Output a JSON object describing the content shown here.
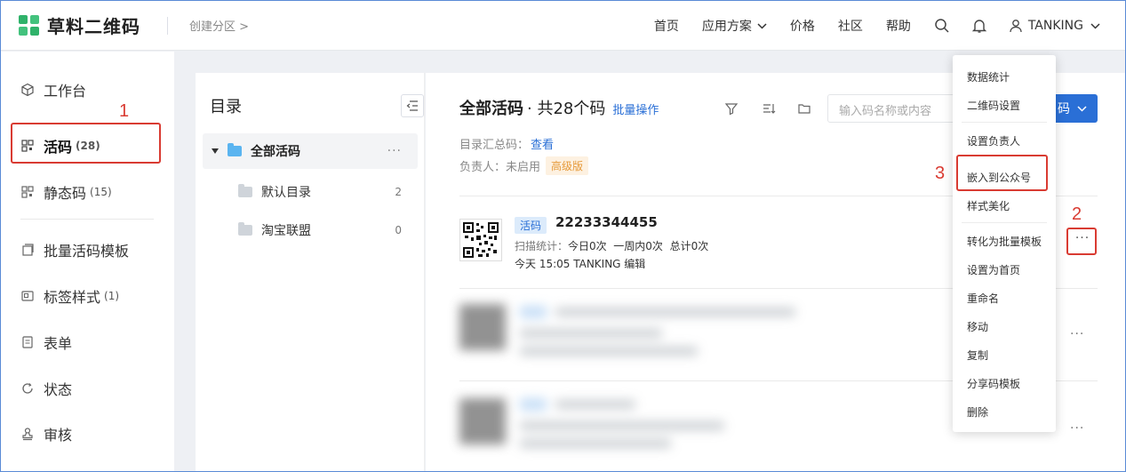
{
  "header": {
    "brand": "草料二维码",
    "breadcrumb": "创建分区 >",
    "nav": [
      {
        "label": "首页"
      },
      {
        "label": "应用方案"
      },
      {
        "label": "价格"
      },
      {
        "label": "社区"
      },
      {
        "label": "帮助"
      }
    ],
    "user": "TANKING"
  },
  "sidebar": {
    "items": [
      {
        "label": "工作台",
        "count": ""
      },
      {
        "label": "活码",
        "count": "(28)"
      },
      {
        "label": "静态码",
        "count": "(15)"
      },
      {
        "label": "批量活码模板",
        "count": ""
      },
      {
        "label": "标签样式",
        "count": "(1)"
      },
      {
        "label": "表单",
        "count": ""
      },
      {
        "label": "状态",
        "count": ""
      },
      {
        "label": "审核",
        "count": ""
      }
    ]
  },
  "directory": {
    "title": "目录",
    "root": "全部活码",
    "children": [
      {
        "label": "默认目录",
        "count": "2"
      },
      {
        "label": "淘宝联盟",
        "count": "0"
      }
    ]
  },
  "main": {
    "title": "全部活码",
    "count_text": "· 共28个码",
    "batch_label": "批量操作",
    "search_placeholder": "输入码名称或内容",
    "create_button": "码",
    "summary_label": "目录汇总码：",
    "summary_link": "查看",
    "owner_label": "负责人：未启用",
    "owner_badge": "高级版",
    "item": {
      "tag": "活码",
      "name": "22233344455",
      "stats_label": "扫描统计：",
      "stats_today": "今日0次",
      "stats_week": "一周内0次",
      "stats_total": "总计0次",
      "time_line": "今天 15:05  TANKING  编辑"
    },
    "more": "···"
  },
  "menu": {
    "items": [
      "数据统计",
      "二维码设置",
      "设置负责人",
      "嵌入到公众号",
      "样式美化",
      "转化为批量模板",
      "设置为首页",
      "重命名",
      "移动",
      "复制",
      "分享码模板",
      "删除"
    ]
  },
  "annotations": {
    "step1": "1",
    "step2": "2",
    "step3": "3"
  },
  "colors": {
    "accent": "#2a6fd6",
    "brand_green": "#2fb26a",
    "annotation_red": "#d93b32",
    "badge_orange": "#e69a3a"
  },
  "icons": {
    "brand": "qr-logo-icon",
    "search": "search-icon",
    "bell": "bell-icon",
    "user": "user-icon",
    "filter": "filter-icon",
    "sort": "sort-icon",
    "folder": "folder-icon"
  }
}
